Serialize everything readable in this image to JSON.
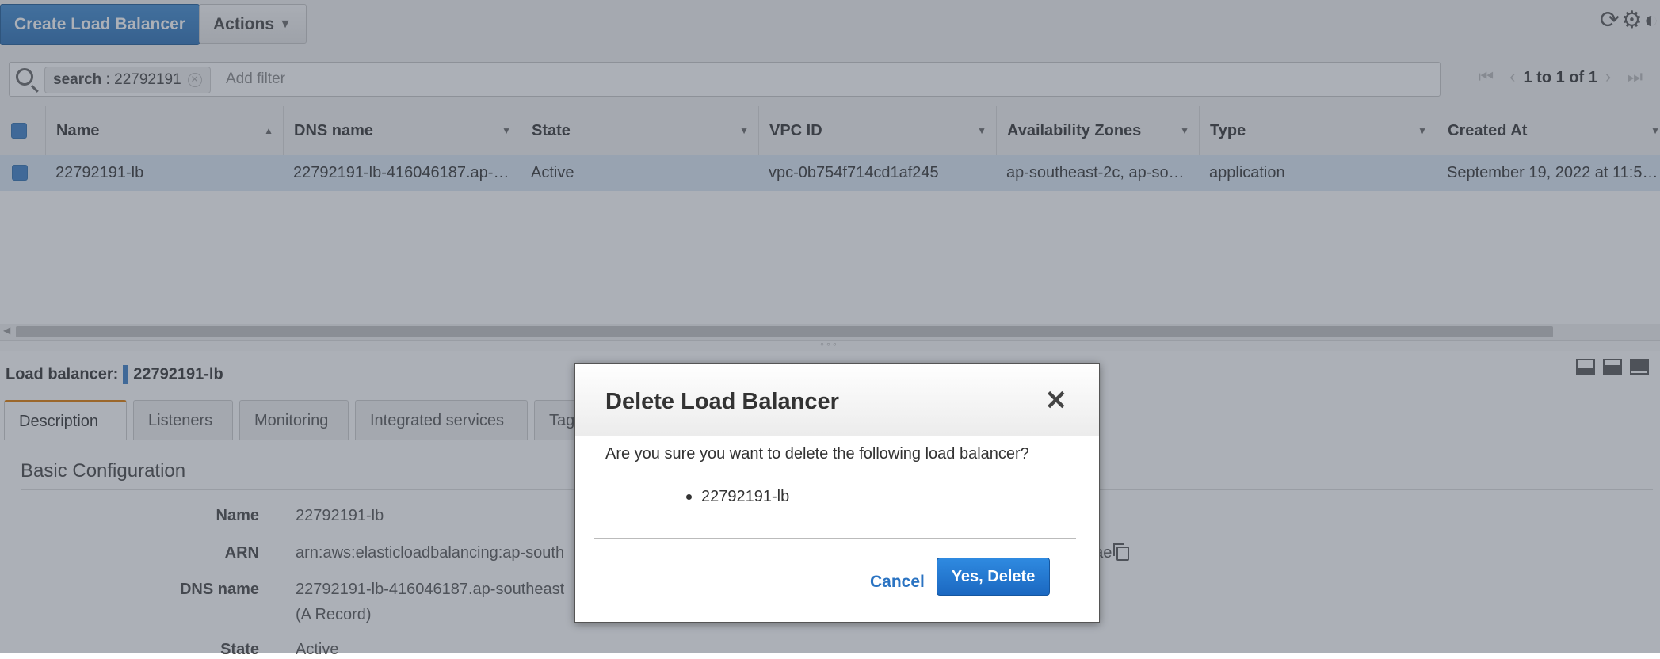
{
  "toolbar": {
    "create_label": "Create Load Balancer",
    "actions_label": "Actions"
  },
  "filter": {
    "token_key": "search",
    "token_sep": " : ",
    "token_value": "22792191",
    "placeholder": "Add filter",
    "pagination": "1 to 1 of 1"
  },
  "table": {
    "columns": [
      "Name",
      "DNS name",
      "State",
      "VPC ID",
      "Availability Zones",
      "Type",
      "Created At"
    ],
    "rows": [
      {
        "name": "22792191-lb",
        "dns": "22792191-lb-416046187.ap-…",
        "state": "Active",
        "vpc": "vpc-0b754f714cd1af245",
        "azs": "ap-southeast-2c, ap-so…",
        "type": "application",
        "created": "September 19, 2022 at 11:5…"
      }
    ]
  },
  "detail": {
    "label": "Load balancer:",
    "name": "22792191-lb",
    "tabs": [
      "Description",
      "Listeners",
      "Monitoring",
      "Integrated services",
      "Tag"
    ],
    "section_title": "Basic Configuration",
    "fields": [
      {
        "key": "Name",
        "value": "22792191-lb"
      },
      {
        "key": "ARN",
        "value": "arn:aws:elasticloadbalancing:ap-south",
        "value_tail": "dae"
      },
      {
        "key": "DNS name",
        "value": "22792191-lb-416046187.ap-southeast",
        "value_line2": "(A Record)"
      },
      {
        "key": "State",
        "value": "Active"
      }
    ]
  },
  "modal": {
    "title": "Delete Load Balancer",
    "close": "✕",
    "message": "Are you sure you want to delete the following load balancer?",
    "item": "22792191-lb",
    "cancel_label": "Cancel",
    "confirm_label": "Yes, Delete"
  },
  "colors": {
    "primary": "#2a6fb5",
    "selected_row": "#dbe8f5",
    "overlay": "rgba(70,80,95,0.45)"
  }
}
